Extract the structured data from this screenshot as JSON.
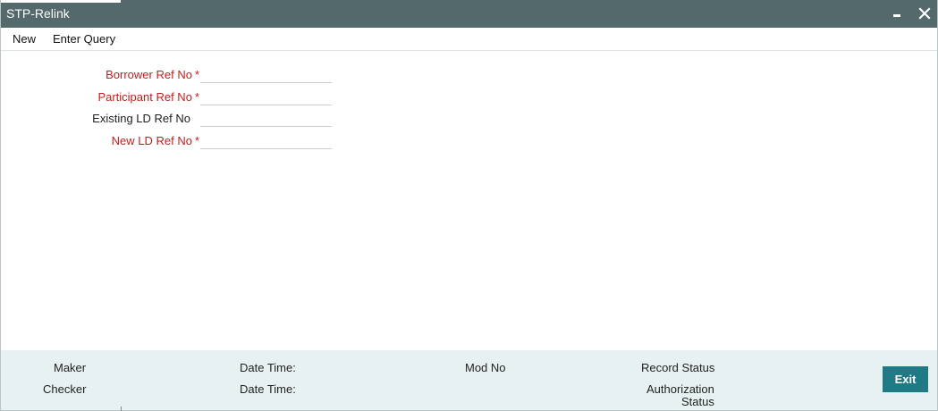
{
  "window": {
    "title": "STP-Relink",
    "minimize_icon": "minimize-icon",
    "close_icon": "close-icon"
  },
  "menu": {
    "new_label": "New",
    "enter_query_label": "Enter Query"
  },
  "form": {
    "fields": [
      {
        "label": "Borrower Ref No",
        "required": true,
        "value": ""
      },
      {
        "label": "Participant Ref No",
        "required": true,
        "value": ""
      },
      {
        "label": "Existing LD Ref No",
        "required": false,
        "value": ""
      },
      {
        "label": "New LD Ref No",
        "required": true,
        "value": ""
      }
    ],
    "required_marker": "*"
  },
  "footer": {
    "maker_label": "Maker",
    "checker_label": "Checker",
    "date_time_label_1": "Date Time:",
    "date_time_label_2": "Date Time:",
    "mod_no_label": "Mod No",
    "record_status_label": "Record Status",
    "authorization_label": "Authorization",
    "status_label": "Status",
    "exit_label": "Exit"
  },
  "colors": {
    "titlebar": "#53696c",
    "required_text": "#c41d1d",
    "footer_bg": "#e8f1f1",
    "exit_button": "#1f7a85"
  }
}
